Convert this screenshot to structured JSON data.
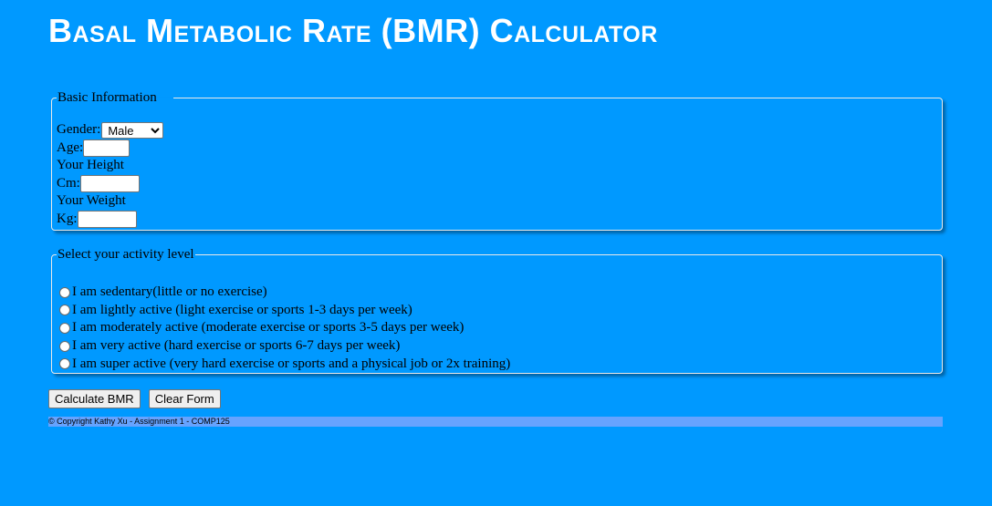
{
  "page": {
    "title": "Basal Metabolic Rate (BMR) Calculator"
  },
  "basic": {
    "legend": "Basic Information",
    "gender_label": "Gender:",
    "gender_selected": "Male",
    "age_label": "Age:",
    "age_value": "",
    "height_heading": "Your Height",
    "cm_label": "Cm:",
    "cm_value": "",
    "weight_heading": "Your Weight",
    "kg_label": "Kg:",
    "kg_value": ""
  },
  "activity": {
    "legend": "Select your activity level",
    "options": [
      {
        "label": "I am sedentary(little or no exercise)",
        "selected": false
      },
      {
        "label": "I am lightly active (light exercise or sports 1-3 days per week)",
        "selected": false
      },
      {
        "label": "I am moderately active (moderate exercise or sports 3-5 days per week)",
        "selected": false
      },
      {
        "label": "I am very active (hard exercise or sports 6-7 days per week)",
        "selected": false
      },
      {
        "label": "I am super active (very hard exercise or sports and a physical job or 2x training)",
        "selected": false
      }
    ]
  },
  "buttons": {
    "calculate": "Calculate BMR",
    "clear": "Clear Form"
  },
  "footer": {
    "text": "© Copyright Kathy Xu - Assignment 1 - COMP125"
  },
  "colors": {
    "background": "#0099ff",
    "title": "#ffffff",
    "footer_bar": "#66a3ff"
  }
}
